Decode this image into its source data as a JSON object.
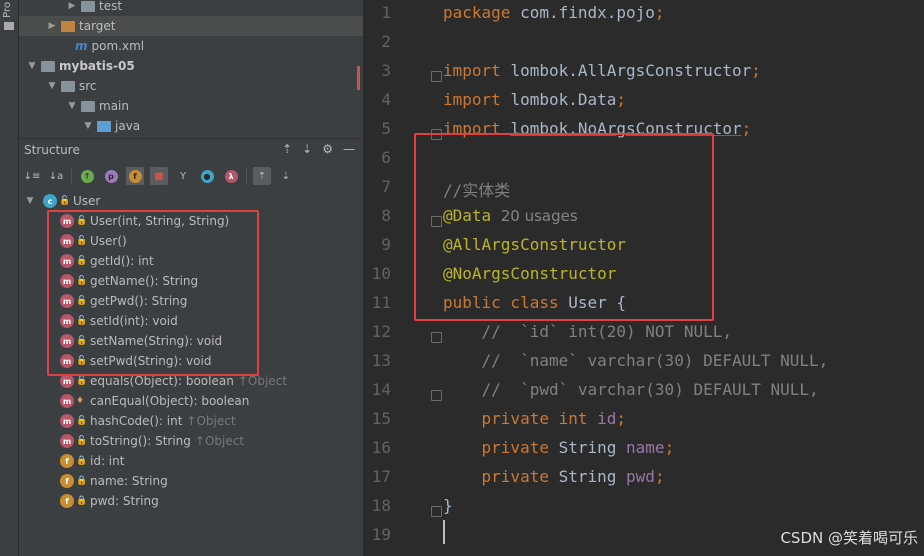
{
  "toolstrip": {
    "label": "Pro"
  },
  "project_tree": [
    {
      "indent": 62,
      "arrow": "▶",
      "icon": "folder",
      "label": "test",
      "bold": false,
      "sel": false
    },
    {
      "indent": 42,
      "arrow": "▶",
      "icon": "folder-orange",
      "label": "target",
      "bold": false,
      "sel": true
    },
    {
      "indent": 56,
      "arrow": "",
      "icon": "maven",
      "label": "pom.xml",
      "bold": false,
      "sel": false
    },
    {
      "indent": 22,
      "arrow": "▼",
      "icon": "module",
      "label": "mybatis-05",
      "bold": true,
      "sel": false
    },
    {
      "indent": 42,
      "arrow": "▼",
      "icon": "folder",
      "label": "src",
      "bold": false,
      "sel": false
    },
    {
      "indent": 62,
      "arrow": "▼",
      "icon": "folder",
      "label": "main",
      "bold": false,
      "sel": false
    },
    {
      "indent": 78,
      "arrow": "▼",
      "icon": "folder-blue",
      "label": "java",
      "bold": false,
      "sel": false
    }
  ],
  "structure": {
    "title": "Structure",
    "root": "User",
    "members": [
      {
        "kind": "m",
        "vis": "public",
        "label": "User(int, String, String)",
        "inherited": ""
      },
      {
        "kind": "m",
        "vis": "public",
        "label": "User()",
        "inherited": ""
      },
      {
        "kind": "m",
        "vis": "public",
        "label": "getId(): int",
        "inherited": ""
      },
      {
        "kind": "m",
        "vis": "public",
        "label": "getName(): String",
        "inherited": ""
      },
      {
        "kind": "m",
        "vis": "public",
        "label": "getPwd(): String",
        "inherited": ""
      },
      {
        "kind": "m",
        "vis": "public",
        "label": "setId(int): void",
        "inherited": ""
      },
      {
        "kind": "m",
        "vis": "public",
        "label": "setName(String): void",
        "inherited": ""
      },
      {
        "kind": "m",
        "vis": "public",
        "label": "setPwd(String): void",
        "inherited": ""
      },
      {
        "kind": "m",
        "vis": "public",
        "label": "equals(Object): boolean",
        "inherited": "↑Object"
      },
      {
        "kind": "m",
        "vis": "protected",
        "label": "canEqual(Object): boolean",
        "inherited": ""
      },
      {
        "kind": "m",
        "vis": "public",
        "label": "hashCode(): int",
        "inherited": "↑Object"
      },
      {
        "kind": "m",
        "vis": "public",
        "label": "toString(): String",
        "inherited": "↑Object"
      },
      {
        "kind": "f",
        "vis": "private",
        "label": "id: int",
        "inherited": ""
      },
      {
        "kind": "f",
        "vis": "private",
        "label": "name: String",
        "inherited": ""
      },
      {
        "kind": "f",
        "vis": "private",
        "label": "pwd: String",
        "inherited": ""
      }
    ]
  },
  "editor": {
    "line_numbers": [
      "1",
      "2",
      "3",
      "4",
      "5",
      "6",
      "7",
      "8",
      "9",
      "10",
      "11",
      "12",
      "13",
      "14",
      "15",
      "16",
      "17",
      "18",
      "19"
    ],
    "lines": [
      [
        [
          "kw",
          "package "
        ],
        [
          "",
          "com.findx.pojo"
        ],
        [
          "kw",
          ";"
        ]
      ],
      [],
      [
        [
          "kw",
          "import "
        ],
        [
          "",
          "lombok.AllArgsConstructor"
        ],
        [
          "kw",
          ";"
        ]
      ],
      [
        [
          "kw",
          "import "
        ],
        [
          "",
          "lombok.Data"
        ],
        [
          "kw",
          ";"
        ]
      ],
      [
        [
          "kw",
          "import "
        ],
        [
          "",
          "lombok.NoArgsConstructor"
        ],
        [
          "kw",
          ";"
        ]
      ],
      [],
      [
        [
          "cm",
          "//实体类"
        ]
      ],
      [
        [
          "an",
          "@Data"
        ],
        [
          "hint",
          "  20 usages"
        ]
      ],
      [
        [
          "an",
          "@AllArgsConstructor"
        ]
      ],
      [
        [
          "an",
          "@NoArgsConstructor"
        ]
      ],
      [
        [
          "kw",
          "public class "
        ],
        [
          "",
          "User {"
        ]
      ],
      [
        [
          "cm",
          "    //  `id` int(20) NOT NULL,"
        ]
      ],
      [
        [
          "cm",
          "    //  `name` varchar(30) DEFAULT NULL,"
        ]
      ],
      [
        [
          "cm",
          "    //  `pwd` varchar(30) DEFAULT NULL,"
        ]
      ],
      [
        [
          "kw",
          "    private int "
        ],
        [
          "fld",
          "id"
        ],
        [
          "kw",
          ";"
        ]
      ],
      [
        [
          "kw",
          "    private "
        ],
        [
          "",
          "String "
        ],
        [
          "fld",
          "name"
        ],
        [
          "kw",
          ";"
        ]
      ],
      [
        [
          "kw",
          "    private "
        ],
        [
          "",
          "String "
        ],
        [
          "fld",
          "pwd"
        ],
        [
          "kw",
          ";"
        ]
      ],
      [
        [
          "",
          "}"
        ]
      ],
      []
    ]
  },
  "watermark": "CSDN @笑着喝可乐",
  "colors": {
    "highlight_box": "#e04040",
    "keyword": "#cc7832",
    "annotation": "#bbb529",
    "field": "#9876aa",
    "comment": "#808080"
  }
}
